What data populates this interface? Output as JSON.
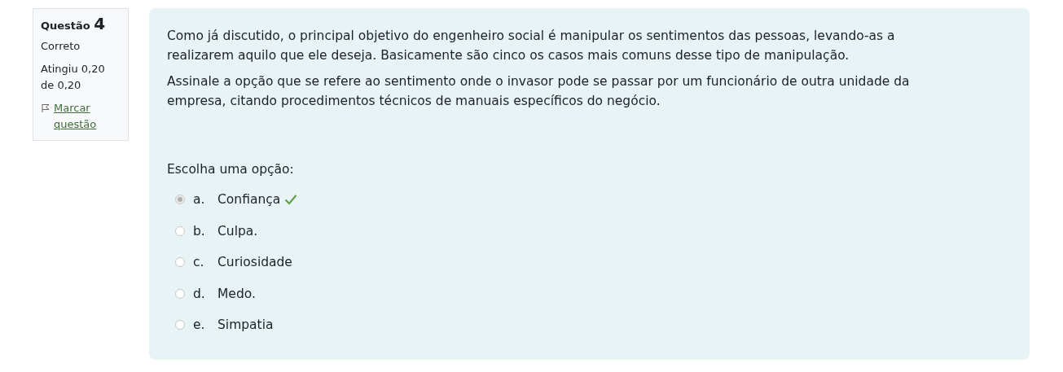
{
  "info": {
    "label": "Questão",
    "number": "4",
    "state": "Correto",
    "grade": "Atingiu 0,20 de 0,20",
    "flag_link": "Marcar questão"
  },
  "question": {
    "paragraphs": [
      "Como já discutido, o principal objetivo do engenheiro social é manipular os sentimentos das pessoas, levando-as a realizarem aquilo que ele deseja. Basicamente são cinco os casos mais comuns desse tipo de manipulação.",
      "Assinale a opção que se refere ao sentimento onde o invasor pode se passar por um funcionário de outra unidade da empresa, citando procedimentos técnicos de manuais específicos do negócio."
    ],
    "prompt": "Escolha uma opção:",
    "options": [
      {
        "letter": "a.",
        "text": "Confiança",
        "selected": true,
        "correct": true
      },
      {
        "letter": "b.",
        "text": "Culpa.",
        "selected": false,
        "correct": false
      },
      {
        "letter": "c.",
        "text": "Curiosidade",
        "selected": false,
        "correct": false
      },
      {
        "letter": "d.",
        "text": "Medo.",
        "selected": false,
        "correct": false
      },
      {
        "letter": "e.",
        "text": "Simpatia",
        "selected": false,
        "correct": false
      }
    ]
  }
}
